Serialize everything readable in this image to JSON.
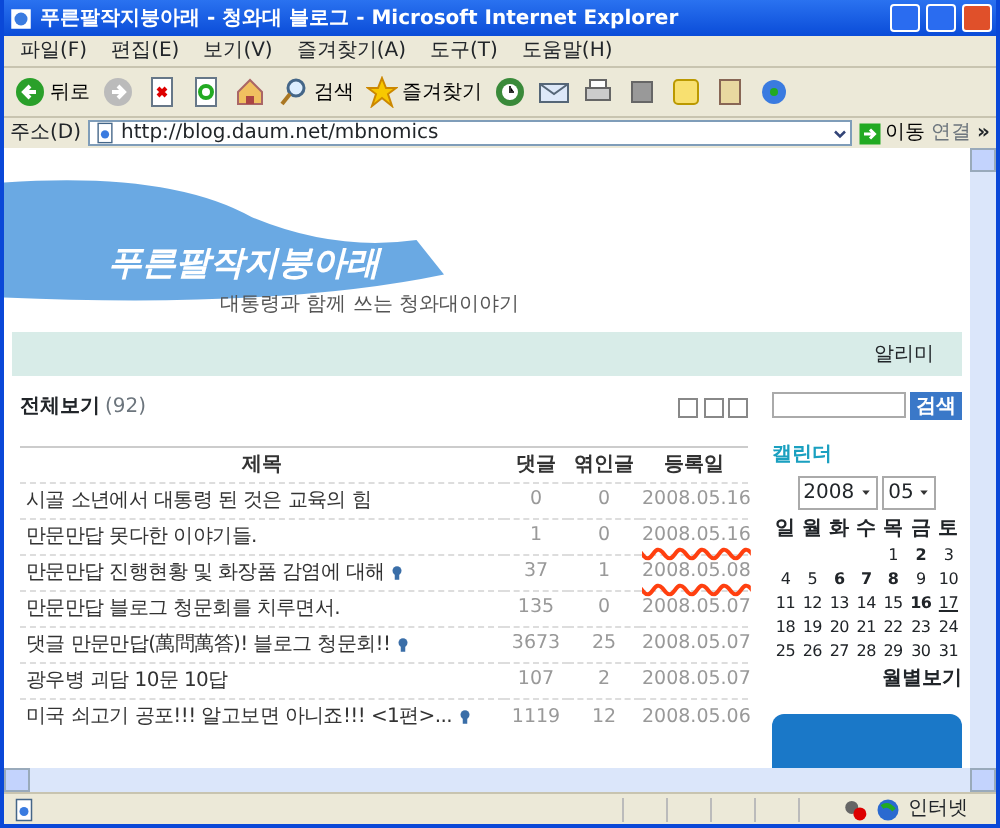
{
  "window": {
    "title": "푸른팔작지붕아래 - 청와대 블로그 - Microsoft Internet Explorer"
  },
  "menu": [
    "파일(F)",
    "편집(E)",
    "보기(V)",
    "즐겨찾기(A)",
    "도구(T)",
    "도움말(H)"
  ],
  "toolbar": [
    {
      "kind": "back",
      "label": "뒤로"
    },
    {
      "kind": "forward"
    },
    {
      "kind": "stop"
    },
    {
      "kind": "refresh"
    },
    {
      "kind": "home"
    },
    {
      "kind": "search",
      "label": "검색"
    },
    {
      "kind": "favorites",
      "label": "즐겨찾기"
    },
    {
      "kind": "history"
    },
    {
      "kind": "mail"
    },
    {
      "kind": "print"
    },
    {
      "kind": "edit"
    },
    {
      "kind": "notes"
    },
    {
      "kind": "research"
    },
    {
      "kind": "messenger"
    }
  ],
  "address": {
    "label": "주소(D)",
    "url": "http://blog.daum.net/mbnomics",
    "go": "이동",
    "links": "연결",
    "more": "»"
  },
  "blog": {
    "title": "푸른팔작지붕아래",
    "subtitle": "대통령과 함께 쓰는 청와대이야기",
    "notice": "알리미"
  },
  "post_list": {
    "heading": "전체보기",
    "count": "(92)",
    "columns": [
      "제목",
      "댓글",
      "엮인글",
      "등록일"
    ],
    "rows": [
      {
        "title": "시골 소년에서 대통령 된 것은 교육의 힘",
        "has_icon": false,
        "comments": "0",
        "trackbacks": "0",
        "date": "2008.05.16",
        "underlined": false
      },
      {
        "title": "만문만답 못다한 이야기들.",
        "has_icon": false,
        "comments": "1",
        "trackbacks": "0",
        "date": "2008.05.16",
        "underlined": true
      },
      {
        "title": "만문만답 진행현황 및 화장품 감염에 대해",
        "has_icon": true,
        "comments": "37",
        "trackbacks": "1",
        "date": "2008.05.08",
        "underlined": true
      },
      {
        "title": "만문만답 블로그 청문회를 치루면서.",
        "has_icon": false,
        "comments": "135",
        "trackbacks": "0",
        "date": "2008.05.07",
        "underlined": false
      },
      {
        "title": "댓글 만문만답(萬問萬答)! 블로그 청문회!!",
        "has_icon": true,
        "comments": "3673",
        "trackbacks": "25",
        "date": "2008.05.07",
        "underlined": false
      },
      {
        "title": "광우병 괴담 10문 10답",
        "has_icon": false,
        "comments": "107",
        "trackbacks": "2",
        "date": "2008.05.07",
        "underlined": false
      },
      {
        "title": "미국 쇠고기 공포!!! 알고보면 아니죠!!! <1편>...",
        "has_icon": true,
        "comments": "1119",
        "trackbacks": "12",
        "date": "2008.05.06",
        "underlined": false
      }
    ]
  },
  "search": {
    "button": "검색"
  },
  "calendar": {
    "title": "캘린더",
    "year": "2008",
    "month": "05",
    "weekdays": [
      "일",
      "월",
      "화",
      "수",
      "목",
      "금",
      "토"
    ],
    "weeks": [
      [
        {
          "day": "1",
          "bold": false,
          "today": false
        },
        {
          "day": "2",
          "bold": true,
          "today": false
        },
        {
          "day": "3",
          "bold": false,
          "today": false
        }
      ],
      [
        {
          "day": "4",
          "bold": false,
          "today": false
        },
        {
          "day": "5",
          "bold": false,
          "today": false
        },
        {
          "day": "6",
          "bold": true,
          "today": false
        },
        {
          "day": "7",
          "bold": true,
          "today": false
        },
        {
          "day": "8",
          "bold": true,
          "today": false
        },
        {
          "day": "9",
          "bold": false,
          "today": false
        },
        {
          "day": "10",
          "bold": false,
          "today": false
        }
      ],
      [
        {
          "day": "11",
          "bold": false,
          "today": false
        },
        {
          "day": "12",
          "bold": false,
          "today": false
        },
        {
          "day": "13",
          "bold": false,
          "today": false
        },
        {
          "day": "14",
          "bold": false,
          "today": false
        },
        {
          "day": "15",
          "bold": false,
          "today": false
        },
        {
          "day": "16",
          "bold": true,
          "today": false
        },
        {
          "day": "17",
          "bold": false,
          "today": true
        }
      ],
      [
        {
          "day": "18",
          "bold": false,
          "today": false
        },
        {
          "day": "19",
          "bold": false,
          "today": false
        },
        {
          "day": "20",
          "bold": false,
          "today": false
        },
        {
          "day": "21",
          "bold": false,
          "today": false
        },
        {
          "day": "22",
          "bold": false,
          "today": false
        },
        {
          "day": "23",
          "bold": false,
          "today": false
        },
        {
          "day": "24",
          "bold": false,
          "today": false
        }
      ],
      [
        {
          "day": "25",
          "bold": false,
          "today": false
        },
        {
          "day": "26",
          "bold": false,
          "today": false
        },
        {
          "day": "27",
          "bold": false,
          "today": false
        },
        {
          "day": "28",
          "bold": false,
          "today": false
        },
        {
          "day": "29",
          "bold": false,
          "today": false
        },
        {
          "day": "30",
          "bold": false,
          "today": false
        },
        {
          "day": "31",
          "bold": false,
          "today": false
        }
      ]
    ],
    "link": "월별보기"
  },
  "status_bar": {
    "zone": "인터넷"
  }
}
